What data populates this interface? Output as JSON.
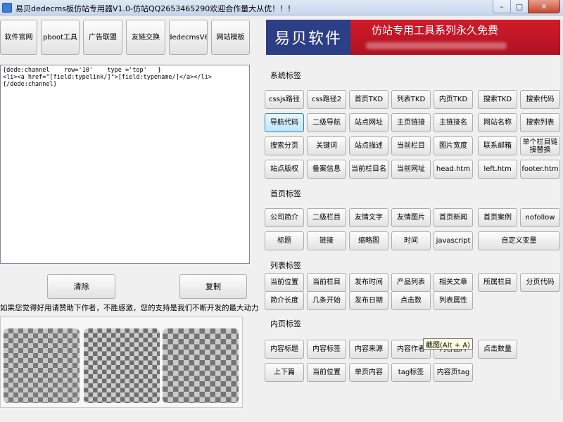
{
  "window": {
    "title": "易贝dedecms板仿站专用器V1.0-仿站QQ2653465290欢迎合作量大从优！！！",
    "controls": {
      "minimize": "–",
      "maximize": "□",
      "close": "✕"
    }
  },
  "top_buttons": [
    "软件官网",
    "pboot工具",
    "广告联盟",
    "友链交换",
    "dedecmsV6",
    "网站模板"
  ],
  "editor": {
    "content": "{dede:channel    row='10'    type ='top'   }\n<li><a href=\"[field:typelink/]\">[field:typename/]</a></li>\n{/dede:channel}"
  },
  "actions": {
    "clear": "清除",
    "copy": "复制"
  },
  "notice": "如果您觉得好用请赞助下作者，不胜感激，您的支持是我们不断开发的最大动力",
  "banner": {
    "brand": "易贝软件",
    "tagline": "仿站专用工具系列永久免费"
  },
  "sections": {
    "system": {
      "title": "系统标签",
      "buttons": [
        "cssjs路径",
        "css路径2",
        "首页TKD",
        "列表TKD",
        "内页TKD",
        "搜索TKD",
        "搜索代码",
        "导航代码",
        "二级导航",
        "站点网址",
        "主页链接",
        "主链接名",
        "网站名称",
        "搜索列表",
        "搜索分页",
        "关键词",
        "站点描述",
        "当前栏目",
        "图片宽度",
        "联系邮箱",
        "单个栏目链接替换",
        "站点版权",
        "备案信息",
        "当前栏目名",
        "当前网址",
        "head.htm",
        "left.htm",
        "footer.htm"
      ]
    },
    "home": {
      "title": "首页标签",
      "buttons": [
        "公司简介",
        "二级栏目",
        "友情文字",
        "友情图片",
        "首页新闻",
        "首页案例",
        "nofollow",
        "标题",
        "链接",
        "缩略图",
        "时间",
        "javascript",
        "自定义变量"
      ]
    },
    "list": {
      "title": "列表标签",
      "buttons": [
        "当前位置",
        "当前栏目",
        "发布时间",
        "产品列表",
        "相关文章",
        "所属栏目",
        "分页代码",
        "简介长度",
        "几条开始",
        "发布日期",
        "点击数",
        "列表属性"
      ]
    },
    "content": {
      "title": "内页标签",
      "buttons": [
        "内容标题",
        "内容标签",
        "内容来源",
        "内容作者",
        "内容图片",
        "点击数量",
        "上下篇",
        "当前位置",
        "单页内容",
        "tag标签",
        "内容页tag"
      ]
    }
  },
  "tooltip": "截图(Alt + A)",
  "colors": {
    "banner_blue": "#2c3e86",
    "banner_red": "#c8162a",
    "selected_button": "#bde6fd"
  }
}
